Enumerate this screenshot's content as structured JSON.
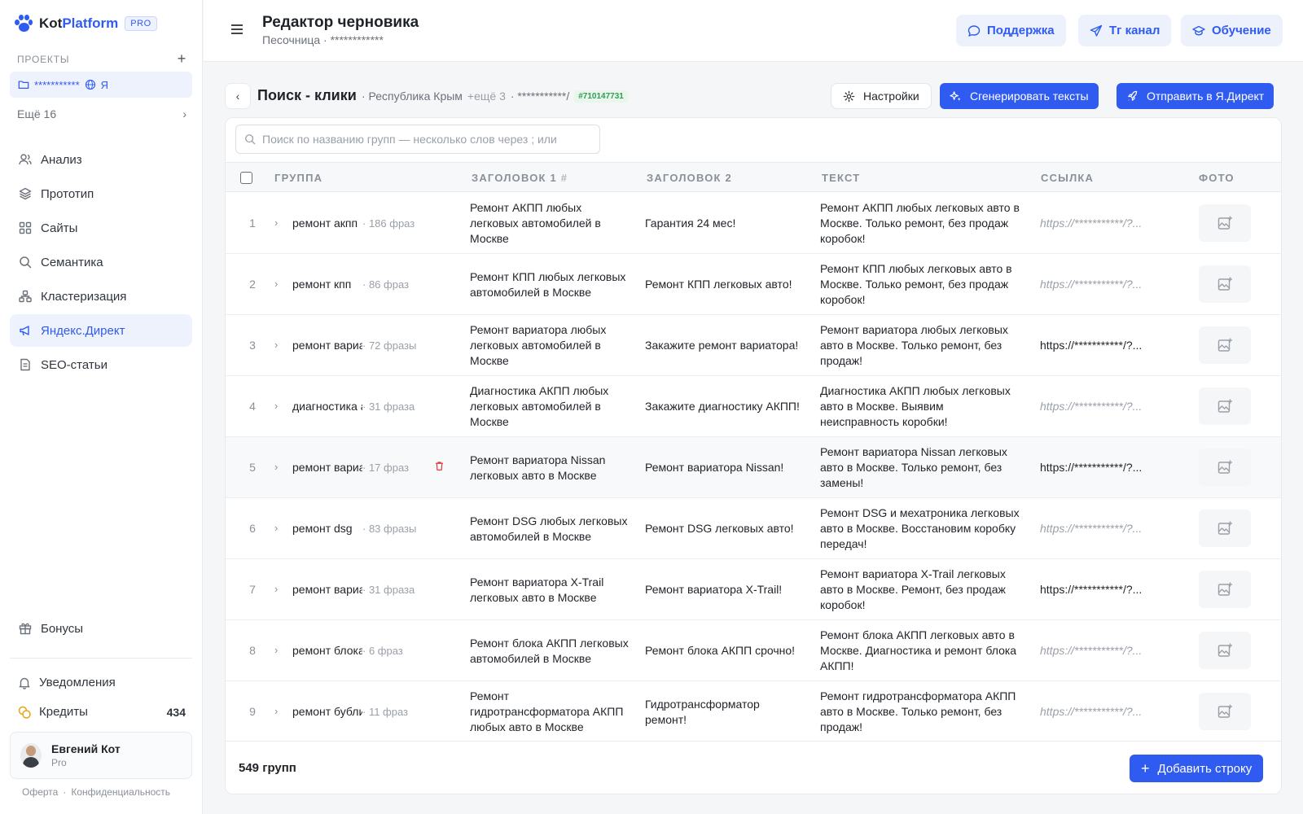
{
  "app": {
    "name_part1": "Kot",
    "name_part2": "Platform",
    "badge": "PRO"
  },
  "sidebar": {
    "projects_label": "ПРОЕКТЫ",
    "project": {
      "name": "***********",
      "lang": "Я"
    },
    "more_label": "Ещё 16",
    "nav": [
      {
        "label": "Анализ",
        "icon": "users-icon",
        "active": false
      },
      {
        "label": "Прототип",
        "icon": "layers-icon",
        "active": false
      },
      {
        "label": "Сайты",
        "icon": "grid-icon",
        "active": false
      },
      {
        "label": "Семантика",
        "icon": "search-icon",
        "active": false
      },
      {
        "label": "Кластеризация",
        "icon": "cluster-icon",
        "active": false
      },
      {
        "label": "Яндекс.Директ",
        "icon": "megaphone-icon",
        "active": true
      },
      {
        "label": "SEO-статьи",
        "icon": "document-icon",
        "active": false
      }
    ],
    "bonus_label": "Бонусы",
    "notifications_label": "Уведомления",
    "credits_label": "Кредиты",
    "credits_value": "434",
    "user": {
      "name": "Евгений Кот",
      "plan": "Pro"
    },
    "footer": {
      "offer": "Оферта",
      "dot": "·",
      "privacy": "Конфиденциальность"
    }
  },
  "header": {
    "title": "Редактор черновика",
    "subtitle": "Песочница · ************",
    "buttons": {
      "support": "Поддержка",
      "tg": "Тг канал",
      "learn": "Обучение"
    }
  },
  "campaign": {
    "title": "Поиск - клики",
    "region": "· Республика Крым",
    "more": "+ещё 3",
    "url": "· ***********/",
    "id": "#710147731",
    "settings": "Настройки",
    "generate": "Сгенерировать тексты",
    "send": "Отправить в Я.Директ"
  },
  "table": {
    "search_placeholder": "Поиск по названию групп — несколько слов через ;  или",
    "columns": {
      "group": "ГРУППА",
      "h1": "ЗАГОЛОВОК 1",
      "h1_hash": "#",
      "h2": "ЗАГОЛОВОК 2",
      "text": "ТЕКСТ",
      "link": "ССЫЛКА",
      "photo": "ФОТО"
    },
    "rows": [
      {
        "num": "1",
        "group": "ремонт акпп",
        "phrases": "· 186 фраз",
        "h1": "Ремонт АКПП любых легковых автомобилей в Москве",
        "h2": "Гарантия 24 мес!",
        "text": "Ремонт АКПП любых легковых авто в Москве. Только ремонт, без продаж коробок!",
        "link": "https://***********/?...",
        "link_faded": true
      },
      {
        "num": "2",
        "group": "ремонт кпп",
        "phrases": "· 86 фраз",
        "h1": "Ремонт КПП любых легковых автомобилей в Москве",
        "h2": "Ремонт КПП легковых авто!",
        "text": "Ремонт КПП любых легковых авто в Москве. Только ремонт, без продаж коробок!",
        "link": "https://***********/?...",
        "link_faded": true
      },
      {
        "num": "3",
        "group": "ремонт вариатора",
        "phrases": "· 72 фразы",
        "h1": "Ремонт вариатора любых легковых автомобилей в Москве",
        "h2": "Закажите ремонт вариатора!",
        "text": "Ремонт вариатора любых легковых авто в Москве. Только ремонт, без продаж!",
        "link": "https://***********/?...",
        "link_faded": false
      },
      {
        "num": "4",
        "group": "диагностика акпп",
        "phrases": "· 31 фраза",
        "h1": "Диагностика АКПП любых легковых автомобилей в Москве",
        "h2": "Закажите диагностику АКПП!",
        "text": "Диагностика АКПП любых легковых авто в Москве. Выявим неисправность коробки!",
        "link": "https://***********/?...",
        "link_faded": true
      },
      {
        "num": "5",
        "group": "ремонт вариатора nissan",
        "phrases": "· 17 фраз",
        "h1": "Ремонт вариатора Nissan легковых авто в Москве",
        "h2": "Ремонт вариатора Nissan!",
        "text": "Ремонт вариатора Nissan легковых авто в Москве. Только ремонт, без замены!",
        "link": "https://***********/?...",
        "link_faded": false,
        "hover": true
      },
      {
        "num": "6",
        "group": "ремонт dsg",
        "phrases": "· 83 фразы",
        "h1": "Ремонт DSG любых легковых автомобилей в Москве",
        "h2": "Ремонт DSG легковых авто!",
        "text": "Ремонт DSG и мехатроника легковых авто в Москве. Восстановим коробку передач!",
        "link": "https://***********/?...",
        "link_faded": true
      },
      {
        "num": "7",
        "group": "ремонт вариатора x-trail",
        "phrases": "· 31 фраза",
        "h1": "Ремонт вариатора X-Trail легковых авто в Москве",
        "h2": "Ремонт вариатора X-Trail!",
        "text": "Ремонт вариатора X-Trail легковых авто в Москве. Ремонт, без продаж коробок!",
        "link": "https://***********/?...",
        "link_faded": false
      },
      {
        "num": "8",
        "group": "ремонт блока акпп",
        "phrases": "· 6 фраз",
        "h1": "Ремонт блока АКПП легковых автомобилей в Москве",
        "h2": "Ремонт блока АКПП срочно!",
        "text": "Ремонт блока АКПП легковых авто в Москве. Диагностика и ремонт блока АКПП!",
        "link": "https://***********/?...",
        "link_faded": true
      },
      {
        "num": "9",
        "group": "ремонт бублика",
        "phrases": "· 11 фраз",
        "h1": "Ремонт гидротрансформатора АКПП любых авто в Москве",
        "h2": "Гидротрансформатор ремонт!",
        "text": "Ремонт гидротрансформатора АКПП авто в Москве. Только ремонт, без продаж!",
        "link": "https://***********/?...",
        "link_faded": true
      }
    ],
    "count": "549 групп",
    "add_row": "Добавить строку"
  },
  "colors": {
    "accent": "#2f5bf0",
    "danger": "#e03e3e",
    "id_badge": "#2f9e52"
  }
}
